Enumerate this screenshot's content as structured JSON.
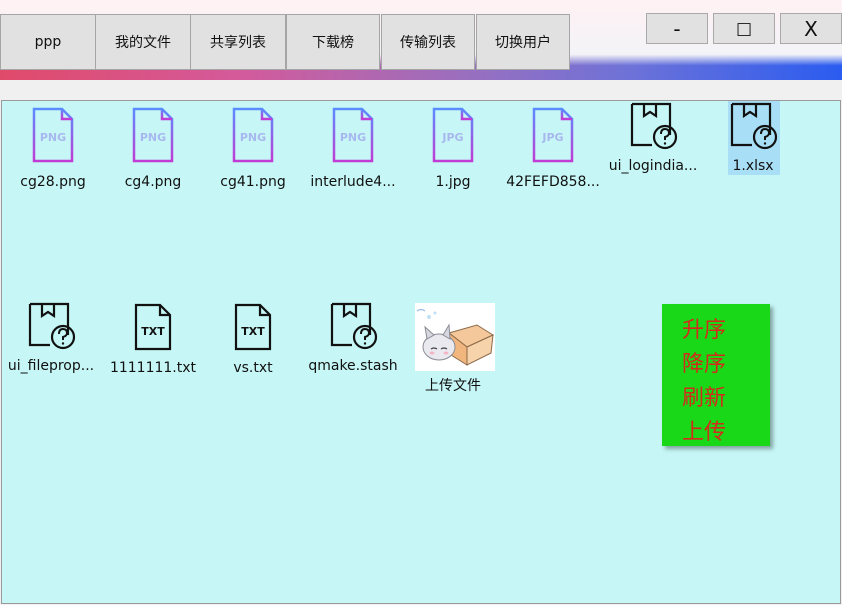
{
  "nav": {
    "user": "ppp",
    "my_files": "我的文件",
    "shared_list": "共享列表",
    "download_rank": "下载榜",
    "transfer_list": "传输列表",
    "switch_user": "切换用户"
  },
  "window_controls": {
    "minimize": "-",
    "maximize": "□",
    "close": "X"
  },
  "files": [
    {
      "name": "cg28.png",
      "type": "PNG",
      "icon": "png-file-icon"
    },
    {
      "name": "cg4.png",
      "type": "PNG",
      "icon": "png-file-icon"
    },
    {
      "name": "cg41.png",
      "type": "PNG",
      "icon": "png-file-icon"
    },
    {
      "name": "interlude4...",
      "type": "PNG",
      "icon": "png-file-icon"
    },
    {
      "name": "1.jpg",
      "type": "JPG",
      "icon": "jpg-file-icon"
    },
    {
      "name": "42FEFD858...",
      "type": "JPG",
      "icon": "jpg-file-icon"
    },
    {
      "name": "ui_logindia...",
      "type": "?",
      "icon": "unknown-file-icon"
    },
    {
      "name": "1.xlsx",
      "type": "?",
      "icon": "unknown-file-icon",
      "selected": true
    },
    {
      "name": "ui_fileprop...",
      "type": "?",
      "icon": "unknown-file-icon"
    },
    {
      "name": "1111111.txt",
      "type": "TXT",
      "icon": "txt-file-icon"
    },
    {
      "name": "vs.txt",
      "type": "TXT",
      "icon": "txt-file-icon"
    },
    {
      "name": "qmake.stash",
      "type": "?",
      "icon": "unknown-file-icon"
    }
  ],
  "upload": {
    "label": "上传文件",
    "icon": "upload-thumbnail-image"
  },
  "context_menu": {
    "asc": "升序",
    "desc": "降序",
    "refresh": "刷新",
    "upload": "上传"
  },
  "colors": {
    "content_bg": "#c6f7f6",
    "selection": "#a9dff6",
    "menu_bg": "#18d818",
    "menu_text": "#d12d1a",
    "png_gradient_start": "#5b8cff",
    "png_gradient_end": "#c23bd4"
  }
}
